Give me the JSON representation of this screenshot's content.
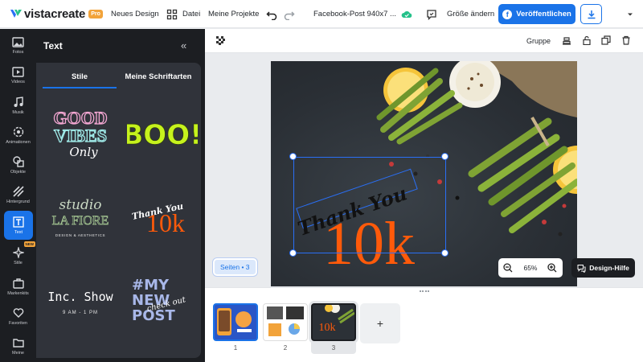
{
  "app": {
    "logo_text": "vistacreate",
    "pro_badge": "Pro"
  },
  "topbar": {
    "new_design": "Neues Design",
    "file": "Datei",
    "my_projects": "Meine Projekte",
    "doc_title": "Facebook-Post 940x7 ...",
    "resize": "Größe ändern",
    "publish": "Veröffentlichen"
  },
  "rail": {
    "items": [
      {
        "label": "Fotos",
        "icon": "photo-icon"
      },
      {
        "label": "Videos",
        "icon": "video-icon"
      },
      {
        "label": "Musik",
        "icon": "music-icon"
      },
      {
        "label": "Animationen",
        "icon": "animation-icon"
      },
      {
        "label": "Objekte",
        "icon": "objects-icon"
      },
      {
        "label": "Hintergrund",
        "icon": "background-icon"
      },
      {
        "label": "Text",
        "icon": "text-icon"
      },
      {
        "label": "Stile",
        "icon": "styles-icon"
      },
      {
        "label": "Markenkits",
        "icon": "brandkit-icon"
      },
      {
        "label": "Favoriten",
        "icon": "heart-icon"
      },
      {
        "label": "Meine",
        "icon": "folder-icon"
      }
    ],
    "new_badge": "NEW"
  },
  "panel": {
    "title": "Text",
    "tabs": [
      "Stile",
      "Meine Schriftarten"
    ],
    "styles": [
      {
        "line1": "GOOD",
        "line2": "VIBES",
        "line3": "Only"
      },
      {
        "line1": "BOO!"
      },
      {
        "line1": "studio",
        "line2": "LA FIORE",
        "line3": "DESIGN & AESTHETICS"
      },
      {
        "line1": "Thank You",
        "line2": "10k"
      },
      {
        "line1": "Inc. Show",
        "line2": "9 AM - 1 PM"
      },
      {
        "line1": "#MY",
        "line2": "NEW",
        "line3": "POST",
        "line4": "check out"
      }
    ]
  },
  "canvas": {
    "toolbar": {
      "group": "Gruppe"
    },
    "headline_script": "Thank You",
    "headline_big": "10k",
    "pages_label": "Seiten • 3",
    "zoom": "65%",
    "design_help": "Design-Hilfe"
  },
  "pages": {
    "numbers": [
      "1",
      "2",
      "3"
    ],
    "add": "+"
  },
  "colors": {
    "accent": "#1a73e8",
    "orange": "#ff5a0a",
    "dark": "#1c1e22"
  }
}
